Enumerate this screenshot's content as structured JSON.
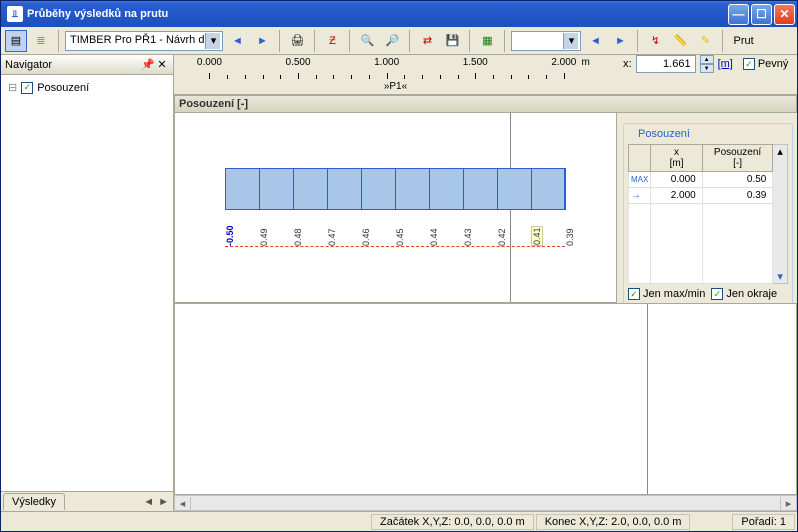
{
  "title": "Průběhy výsledků na prutu",
  "toolbar": {
    "combo": "TIMBER Pro PŘ1 - Návrh d",
    "right_label": "Prut"
  },
  "navigator": {
    "title": "Navigator",
    "item": "Posouzení",
    "tab": "Výsledky"
  },
  "ruler": {
    "ticks": [
      "0.000",
      "0.500",
      "1.000",
      "1.500",
      "2.000"
    ],
    "unit": "m",
    "member": "»P1«"
  },
  "xpanel": {
    "label": "x:",
    "value": "1.661",
    "unit": "[m]",
    "fixed": "Pevný"
  },
  "graph": {
    "title": "Posouzení [-]",
    "labels": [
      "-0.50",
      "0.49",
      "0.48",
      "0.47",
      "0.46",
      "0.45",
      "0.44",
      "0.43",
      "0.42",
      "0.41",
      "0.39"
    ]
  },
  "results": {
    "title": "Posouzení",
    "col_x": "x\n[m]",
    "col_p": "Posouzení\n[-]",
    "rows": [
      {
        "lead": "MAX",
        "x": "0.000",
        "p": "0.50"
      },
      {
        "lead": "→",
        "x": "2.000",
        "p": "0.39"
      }
    ],
    "chk_maxmin": "Jen max/min",
    "chk_edges": "Jen okraje"
  },
  "status": {
    "start": "Začátek X,Y,Z:   0.0, 0.0, 0.0 m",
    "end": "Konec X,Y,Z:   2.0, 0.0, 0.0 m",
    "order": "Pořadí:   1"
  },
  "chart_data": {
    "type": "bar",
    "title": "Posouzení [-]",
    "xlabel": "x [m]",
    "ylabel": "Posouzení [-]",
    "x_range": [
      0.0,
      2.0
    ],
    "series": [
      {
        "name": "Posouzení",
        "x": [
          0.0,
          0.2,
          0.4,
          0.6,
          0.8,
          1.0,
          1.2,
          1.4,
          1.6,
          1.8,
          2.0
        ],
        "values": [
          0.5,
          0.49,
          0.48,
          0.47,
          0.46,
          0.45,
          0.44,
          0.43,
          0.42,
          0.41,
          0.39
        ]
      }
    ],
    "cursor_x": 1.661
  }
}
